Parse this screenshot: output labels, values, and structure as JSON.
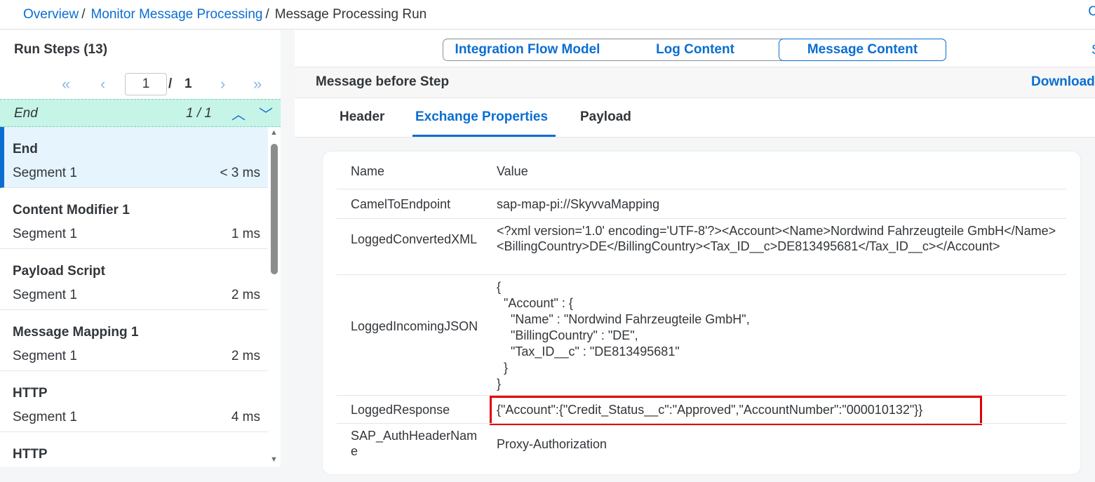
{
  "breadcrumb": {
    "items": [
      "Overview",
      "Monitor Message Processing"
    ],
    "separator": "/",
    "current": "Message Processing Run",
    "right_glyph": "C"
  },
  "run_steps": {
    "title": "Run Steps (13)",
    "pager": {
      "first_icon": "«",
      "prev_icon": "‹",
      "page_value": "1",
      "slash": "/",
      "total": "1",
      "next_icon": "›",
      "last_icon": "»"
    },
    "filter": {
      "label": "End",
      "count": "1 / 1",
      "up_icon": "︿",
      "down_icon": "﹀"
    },
    "steps": [
      {
        "name": "End",
        "segment": "Segment 1",
        "duration": "< 3 ms"
      },
      {
        "name": "Content Modifier 1",
        "segment": "Segment 1",
        "duration": "1 ms"
      },
      {
        "name": "Payload Script",
        "segment": "Segment 1",
        "duration": "2 ms"
      },
      {
        "name": "Message Mapping 1",
        "segment": "Segment 1",
        "duration": "2 ms"
      },
      {
        "name": "HTTP",
        "segment": "Segment 1",
        "duration": "4 ms"
      },
      {
        "name": "HTTP",
        "segment": "",
        "duration": ""
      }
    ]
  },
  "view_tabs": {
    "integration_flow_model": "Integration Flow Model",
    "log_content": "Log Content",
    "message_content": "Message Content",
    "right_glyph": "S"
  },
  "message": {
    "title": "Message before Step",
    "download": "Download"
  },
  "content_tabs": {
    "header": "Header",
    "exchange_properties": "Exchange Properties",
    "payload": "Payload"
  },
  "properties": {
    "col_name": "Name",
    "col_value": "Value",
    "rows": [
      {
        "name": "CamelToEndpoint",
        "value": "sap-map-pi://SkyvvaMapping"
      },
      {
        "name": "LoggedConvertedXML",
        "value": "<?xml version='1.0' encoding='UTF-8'?><Account><Name>Nordwind Fahrzeugteile GmbH</Name><BillingCountry>DE</BillingCountry><Tax_ID__c>DE813495681</Tax_ID__c></Account>"
      },
      {
        "name": "LoggedIncomingJSON",
        "value": "{\n  \"Account\" : {\n    \"Name\" : \"Nordwind Fahrzeugteile GmbH\",\n    \"BillingCountry\" : \"DE\",\n    \"Tax_ID__c\" : \"DE813495681\"\n  }\n}"
      },
      {
        "name": "LoggedResponse",
        "value": "{\"Account\":{\"Credit_Status__c\":\"Approved\",\"AccountNumber\":\"000010132\"}}"
      },
      {
        "name": "SAP_AuthHeaderName",
        "value": "Proxy-Authorization"
      }
    ]
  },
  "colors": {
    "accent": "#0a6ed1",
    "selected_bg": "#e5f4fd",
    "filter_bg": "#c6f4e7",
    "highlight": "#e00000"
  }
}
